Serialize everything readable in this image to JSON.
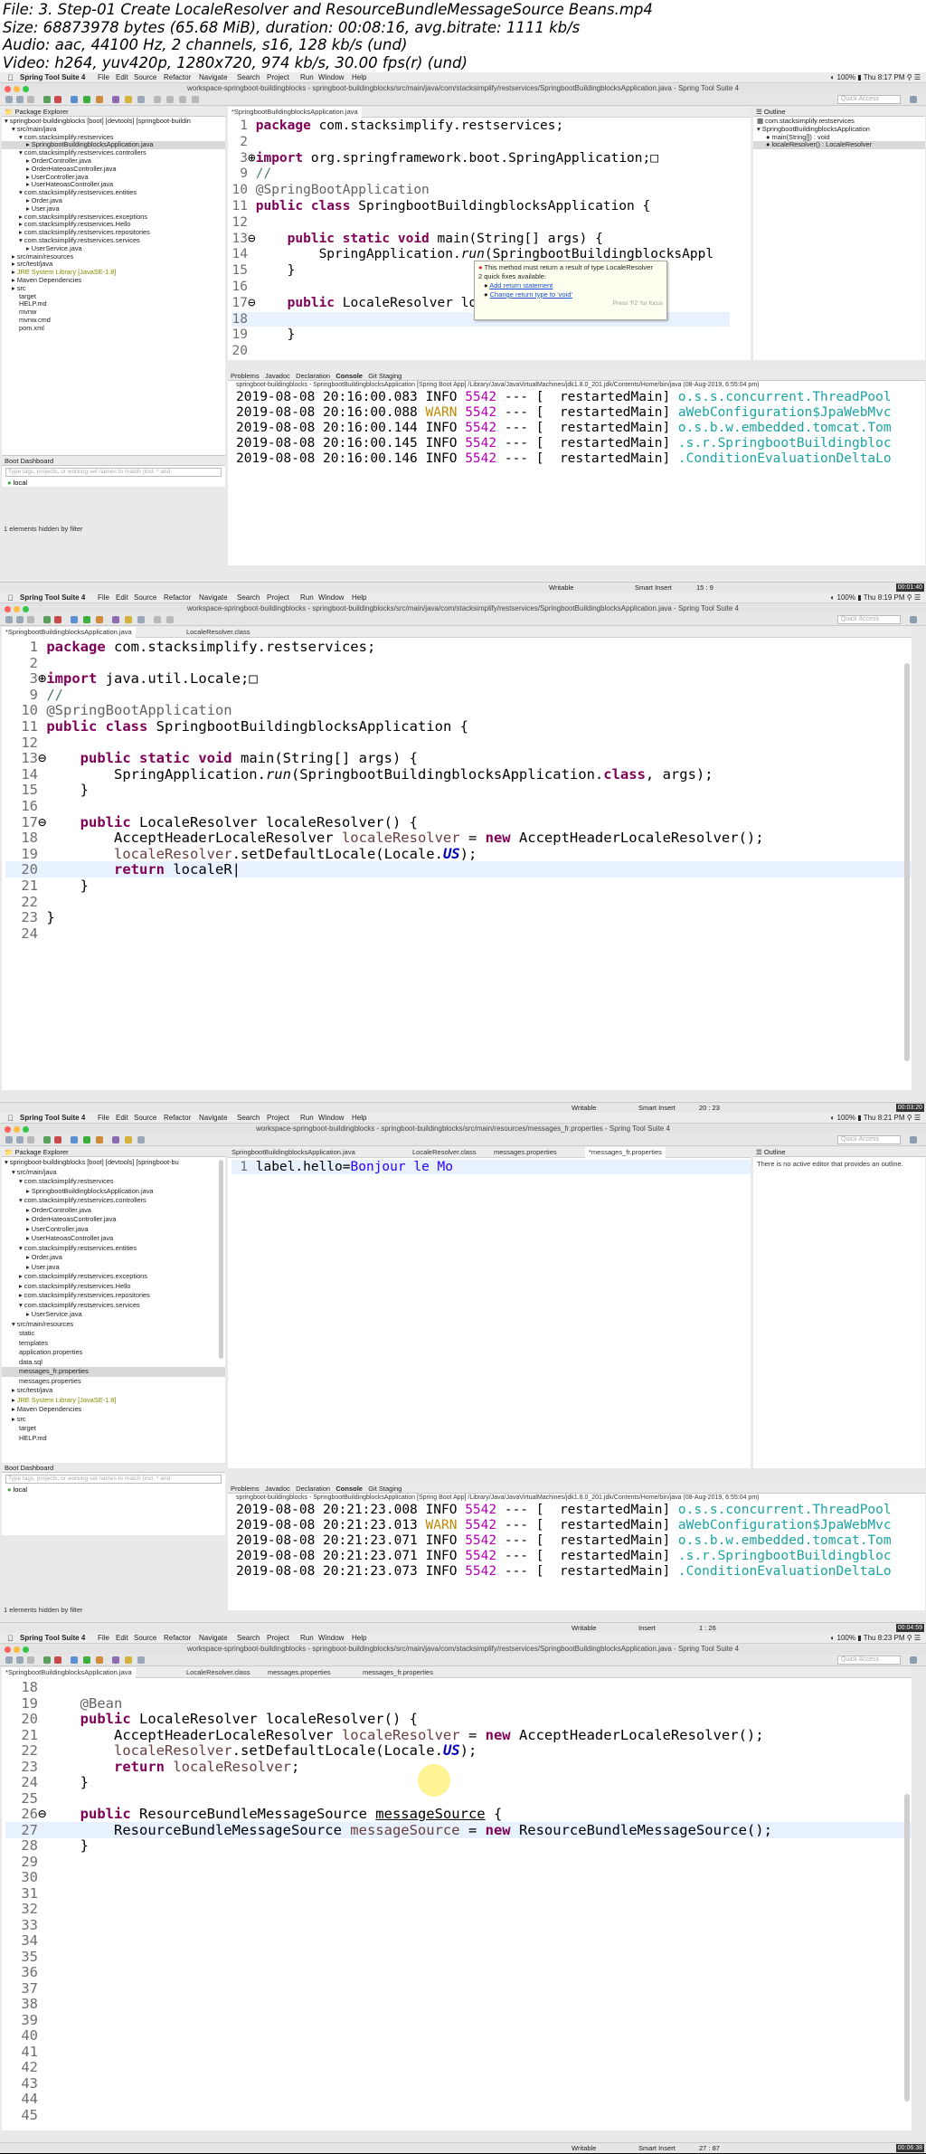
{
  "header": {
    "lines": [
      "File: 3. Step-01 Create LocaleResolver and ResourceBundleMessageSource Beans.mp4",
      "Size: 68873978 bytes (65.68 MiB), duration: 00:08:16, avg.bitrate: 1111 kb/s",
      "Audio: aac, 44100 Hz, 2 channels, s16, 128 kb/s (und)",
      "Video: h264, yuv420p, 1280x720, 974 kb/s, 30.00 fps(r) (und)"
    ]
  },
  "menubar": {
    "app": "Spring Tool Suite 4",
    "items": [
      "File",
      "Edit",
      "Source",
      "Refactor",
      "Navigate",
      "Search",
      "Project",
      "Run",
      "Window",
      "Help"
    ],
    "battery": "100%"
  },
  "quick_access": "Quick Access",
  "frames": [
    {
      "clock": "Thu 8:17 PM",
      "window_title": "workspace-springboot-buildingblocks - springboot-buildingblocks/src/main/java/com/stacksimplify/restservices/SpringbootBuildingblocksApplication.java - Spring Tool Suite 4",
      "explorer_title": "Package Explorer",
      "tree": [
        "springboot-buildingblocks [boot] [devtools] [springboot-buildin",
        "src/main/java",
        "com.stacksimplify.restservices",
        "SpringbootBuildingblocksApplication.java",
        "com.stacksimplify.restservices.controllers",
        "OrderController.java",
        "OrderHateoasController.java",
        "UserController.java",
        "UserHateoasController.java",
        "com.stacksimplify.restservices.entities",
        "Order.java",
        "User.java",
        "com.stacksimplify.restservices.exceptions",
        "com.stacksimplify.restservices.Hello",
        "com.stacksimplify.restservices.repositories",
        "com.stacksimplify.restservices.services",
        "UserService.java",
        "src/main/resources",
        "src/test/java",
        "JRE System Library [JavaSE-1.8]",
        "Maven Dependencies",
        "src",
        "target",
        "HELP.md",
        "mvnw",
        "mvnw.cmd",
        "pom.xml"
      ],
      "editor_tabs": [
        "*SpringbootBuildingblocksApplication.java"
      ],
      "outline_title": "Outline",
      "outline": [
        "com.stacksimplify.restservices",
        "SpringbootBuildingblocksApplication",
        "main(String[]) : void",
        "localeResolver() : LocaleResolver"
      ],
      "quickfix": {
        "title": "This method must return a result of type LocaleResolver",
        "subtitle": "2 quick fixes available:",
        "fixes": [
          "Add return statement",
          "Change return type to 'void'"
        ],
        "hint": "Press 'F2' for focus"
      },
      "boot_dashboard": "Boot Dashboard",
      "boot_filter": "Type tags, projects, or working set names to match (incl. * and",
      "boot_item": "local",
      "hidden_msg": "1 elements hidden by filter",
      "console_tabs": [
        "Problems",
        "Javadoc",
        "Declaration",
        "Console",
        "Git Staging"
      ],
      "console_header": "springboot-buildingblocks - SpringbootBuildingblocksApplication [Spring Boot App] /Library/Java/JavaVirtualMachines/jdk1.8.0_201.jdk/Contents/Home/bin/java (08-Aug-2019, 6:55:04 pm)",
      "console_lines": [
        [
          "2019-08-08 20:16:00.083",
          "INFO",
          "5542",
          "restartedMain",
          "o.s.s.concurrent.ThreadPool"
        ],
        [
          "2019-08-08 20:16:00.088",
          "WARN",
          "5542",
          "restartedMain",
          "aWebConfiguration$JpaWebMvc"
        ],
        [
          "2019-08-08 20:16:00.144",
          "INFO",
          "5542",
          "restartedMain",
          "o.s.b.w.embedded.tomcat.Tom"
        ],
        [
          "2019-08-08 20:16:00.145",
          "INFO",
          "5542",
          "restartedMain",
          ".s.r.SpringbootBuildingbloc"
        ],
        [
          "2019-08-08 20:16:00.146",
          "INFO",
          "5542",
          "restartedMain",
          ".ConditionEvaluationDeltaLo"
        ]
      ],
      "status": {
        "writable": "Writable",
        "mode": "Smart Insert",
        "pos": "15 : 9"
      },
      "timestamp": "00:01:40"
    },
    {
      "clock": "Thu 8:19 PM",
      "window_title": "workspace-springboot-buildingblocks - springboot-buildingblocks/src/main/java/com/stacksimplify/restservices/SpringbootBuildingblocksApplication.java - Spring Tool Suite 4",
      "editor_tabs": [
        "*SpringbootBuildingblocksApplication.java",
        "LocaleResolver.class"
      ],
      "status": {
        "writable": "Writable",
        "mode": "Smart Insert",
        "pos": "20 : 23"
      },
      "timestamp": "00:03:20"
    },
    {
      "clock": "Thu 8:21 PM",
      "window_title": "workspace-springboot-buildingblocks - springboot-buildingblocks/src/main/resources/messages_fr.properties - Spring Tool Suite 4",
      "explorer_title": "Package Explorer",
      "tree": [
        "springboot-buildingblocks [boot] [devtools] [springboot-bu",
        "src/main/java",
        "com.stacksimplify.restservices",
        "SpringbootBuildingblocksApplication.java",
        "com.stacksimplify.restservices.controllers",
        "OrderController.java",
        "OrderHateoasController.java",
        "UserController.java",
        "UserHateoasController.java",
        "com.stacksimplify.restservices.entities",
        "Order.java",
        "User.java",
        "com.stacksimplify.restservices.exceptions",
        "com.stacksimplify.restservices.Hello",
        "com.stacksimplify.restservices.repositories",
        "com.stacksimplify.restservices.services",
        "UserService.java",
        "src/main/resources",
        "static",
        "templates",
        "application.properties",
        "data.sql",
        "messages_fr.properties",
        "messages.properties",
        "src/test/java",
        "JRE System Library [JavaSE-1.8]",
        "Maven Dependencies",
        "src",
        "target",
        "HELP.md"
      ],
      "editor_tabs": [
        "SpringbootBuildingblocksApplication.java",
        "LocaleResolver.class",
        "messages.properties",
        "*messages_fr.properties"
      ],
      "outline_title": "Outline",
      "outline_msg": "There is no active editor that provides an outline.",
      "props_key": "label.hello=",
      "props_val": "Bonjour le Mo",
      "boot_dashboard": "Boot Dashboard",
      "boot_filter": "Type tags, projects, or working set names to match (incl. * and",
      "boot_item": "local",
      "hidden_msg": "1 elements hidden by filter",
      "console_tabs": [
        "Problems",
        "Javadoc",
        "Declaration",
        "Console",
        "Git Staging"
      ],
      "console_header": "springboot-buildingblocks - SpringbootBuildingblocksApplication [Spring Boot App] /Library/Java/JavaVirtualMachines/jdk1.8.0_201.jdk/Contents/Home/bin/java (08-Aug-2019, 6:55:04 pm)",
      "console_lines": [
        [
          "2019-08-08 20:21:23.008",
          "INFO",
          "5542",
          "restartedMain",
          "o.s.s.concurrent.ThreadPool"
        ],
        [
          "2019-08-08 20:21:23.013",
          "WARN",
          "5542",
          "restartedMain",
          "aWebConfiguration$JpaWebMvc"
        ],
        [
          "2019-08-08 20:21:23.071",
          "INFO",
          "5542",
          "restartedMain",
          "o.s.b.w.embedded.tomcat.Tom"
        ],
        [
          "2019-08-08 20:21:23.071",
          "INFO",
          "5542",
          "restartedMain",
          ".s.r.SpringbootBuildingbloc"
        ],
        [
          "2019-08-08 20:21:23.073",
          "INFO",
          "5542",
          "restartedMain",
          ".ConditionEvaluationDeltaLo"
        ]
      ],
      "status": {
        "writable": "Writable",
        "mode": "Insert",
        "pos": "1 : 26"
      },
      "timestamp": "00:04:59"
    },
    {
      "clock": "Thu 8:23 PM",
      "window_title": "workspace-springboot-buildingblocks - springboot-buildingblocks/src/main/java/com/stacksimplify/restservices/SpringbootBuildingblocksApplication.java - Spring Tool Suite 4",
      "editor_tabs": [
        "*SpringbootBuildingblocksApplication.java",
        "LocaleResolver.class",
        "messages.properties",
        "messages_fr.properties"
      ],
      "status": {
        "writable": "Writable",
        "mode": "Smart Insert",
        "pos": "27 : 87"
      },
      "timestamp": "00:06:38"
    }
  ]
}
